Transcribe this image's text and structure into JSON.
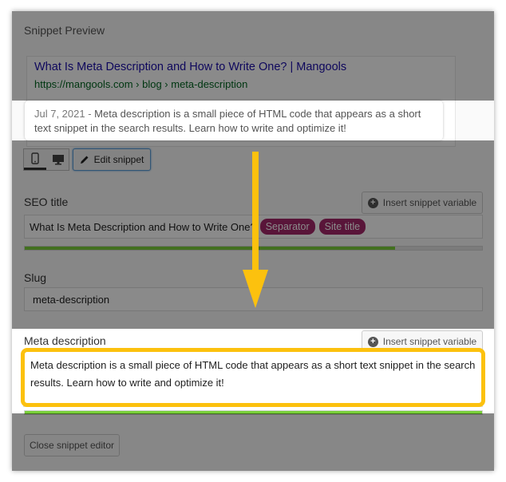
{
  "panel": {
    "title": "Snippet Preview"
  },
  "serp": {
    "title": "What Is Meta Description and How to Write One? | Mangools",
    "url": "https://mangools.com › blog › meta-description",
    "date": "Jul 7, 2021 - ",
    "description": "Meta description is a small piece of HTML code that appears as a short text snippet in the search results. Learn how to write and optimize it!"
  },
  "toolbar": {
    "edit_snippet_label": "Edit snippet",
    "mobile_icon": "mobile-icon",
    "desktop_icon": "desktop-icon",
    "edit_icon": "pencil-icon"
  },
  "seo_title": {
    "label": "SEO title",
    "insert_variable_label": "Insert snippet variable",
    "value": "What Is Meta Description and How to Write One?",
    "pills": [
      "Separator",
      "Site title"
    ],
    "progress": 0.81
  },
  "slug": {
    "label": "Slug",
    "value": "meta-description"
  },
  "meta_description": {
    "label": "Meta description",
    "insert_variable_label": "Insert snippet variable",
    "value": "Meta description is a small piece of HTML code that appears as a short text snippet in the search results. Learn how to write and optimize it!",
    "progress": 1.0
  },
  "footer": {
    "close_label": "Close snippet editor"
  },
  "colors": {
    "highlight": "#fcc10e",
    "progress_green": "#7ad03a",
    "pill": "#a4286a",
    "serp_title": "#1a0dab",
    "serp_url": "#006621"
  }
}
